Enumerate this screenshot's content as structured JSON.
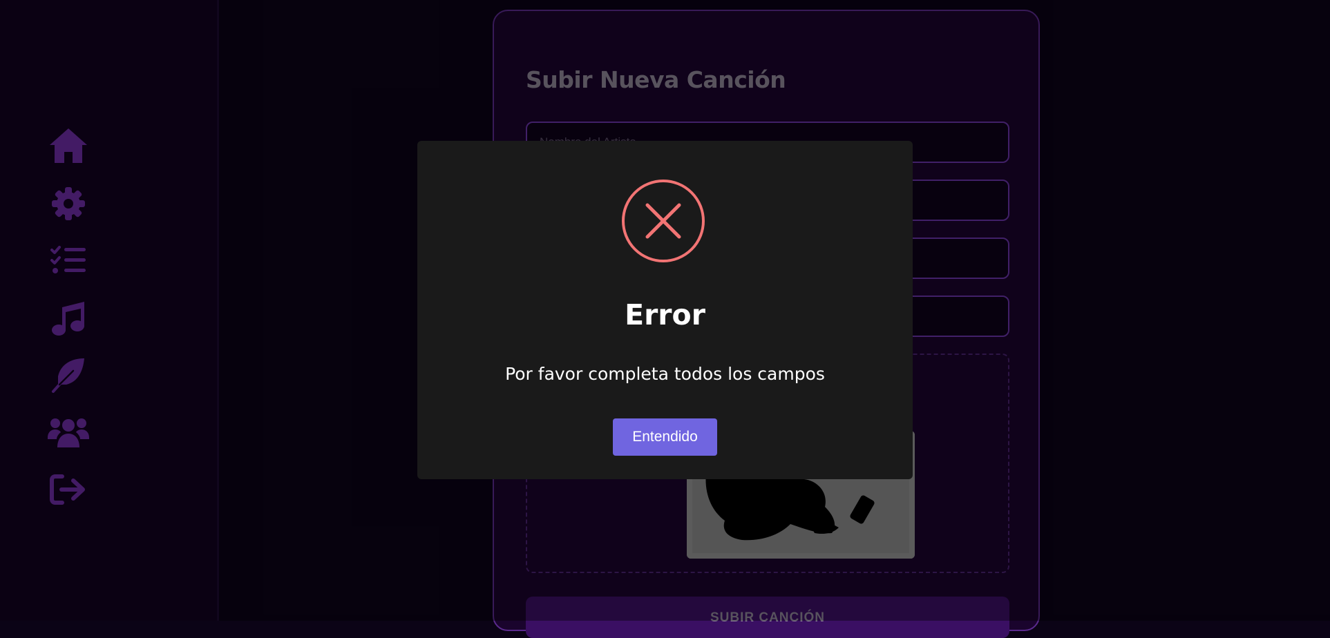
{
  "sidebar": {
    "items": [
      {
        "icon": "home-icon",
        "label": "Inicio"
      },
      {
        "icon": "gear-icon",
        "label": "Configuración"
      },
      {
        "icon": "tasks-icon",
        "label": "Tareas"
      },
      {
        "icon": "music-icon",
        "label": "Música"
      },
      {
        "icon": "feather-icon",
        "label": "Escribir"
      },
      {
        "icon": "users-icon",
        "label": "Usuarios"
      },
      {
        "icon": "logout-icon",
        "label": "Cerrar sesión"
      }
    ],
    "icon_color": "#6d2da3"
  },
  "form": {
    "title": "Subir Nueva Canción",
    "fields": [
      {
        "placeholder": "Nombre del Artista"
      },
      {
        "placeholder": ""
      },
      {
        "placeholder": ""
      },
      {
        "placeholder": ""
      }
    ],
    "submit_label": "SUBIR CANCIÓN"
  },
  "modal": {
    "title": "Error",
    "message": "Por favor completa todos los campos",
    "button_label": "Entendido",
    "icon": "error-x-icon",
    "icon_color": "#f27474",
    "button_color": "#7065e0"
  }
}
